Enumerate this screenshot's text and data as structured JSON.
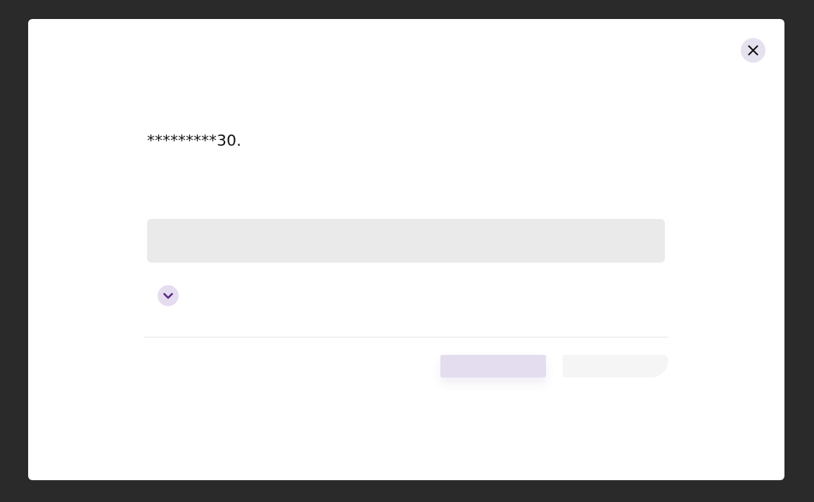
{
  "dialog": {
    "message": "*********30.",
    "expander": {
      "expanded": false
    },
    "actions": [
      {
        "kind": "primary"
      },
      {
        "kind": "secondary"
      }
    ]
  }
}
